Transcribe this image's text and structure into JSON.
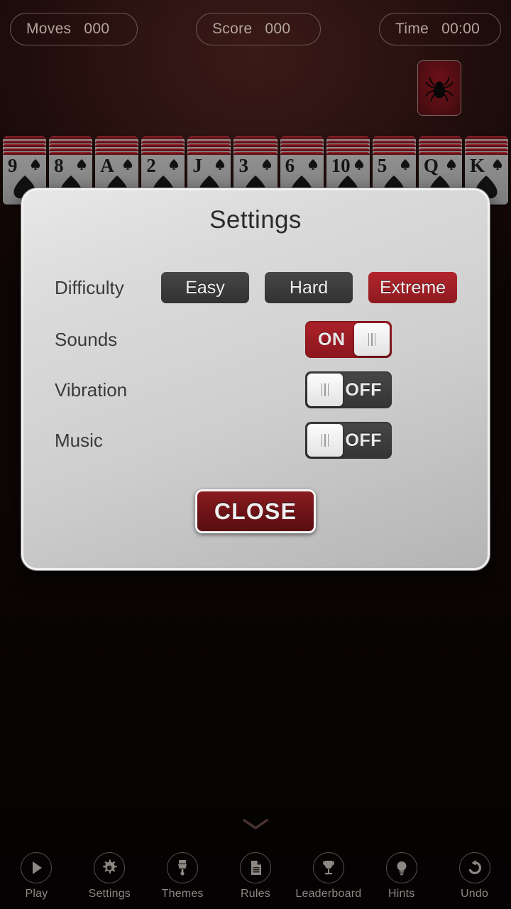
{
  "status": {
    "moves": {
      "label": "Moves",
      "value": "000"
    },
    "score": {
      "label": "Score",
      "value": "000"
    },
    "time": {
      "label": "Time",
      "value": "00:00"
    }
  },
  "stock": {
    "icon": "spider-icon"
  },
  "cards": [
    {
      "rank": "9",
      "suit": "spade"
    },
    {
      "rank": "8",
      "suit": "spade"
    },
    {
      "rank": "A",
      "suit": "spade"
    },
    {
      "rank": "2",
      "suit": "spade"
    },
    {
      "rank": "J",
      "suit": "spade"
    },
    {
      "rank": "3",
      "suit": "spade"
    },
    {
      "rank": "6",
      "suit": "spade"
    },
    {
      "rank": "10",
      "suit": "spade"
    },
    {
      "rank": "5",
      "suit": "spade"
    },
    {
      "rank": "Q",
      "suit": "spade"
    },
    {
      "rank": "K",
      "suit": "spade"
    }
  ],
  "dialog": {
    "title": "Settings",
    "difficulty": {
      "label": "Difficulty",
      "options": [
        "Easy",
        "Hard",
        "Extreme"
      ],
      "selected": "Extreme"
    },
    "sounds": {
      "label": "Sounds",
      "state": "ON"
    },
    "vibration": {
      "label": "Vibration",
      "state": "OFF"
    },
    "music": {
      "label": "Music",
      "state": "OFF"
    },
    "close_label": "CLOSE"
  },
  "chevron": {
    "icon": "chevron-down-icon"
  },
  "nav": [
    {
      "label": "Play",
      "icon": "play-icon"
    },
    {
      "label": "Settings",
      "icon": "gear-icon"
    },
    {
      "label": "Themes",
      "icon": "paintbrush-icon"
    },
    {
      "label": "Rules",
      "icon": "document-icon"
    },
    {
      "label": "Leaderboard",
      "icon": "trophy-icon"
    },
    {
      "label": "Hints",
      "icon": "lightbulb-icon"
    },
    {
      "label": "Undo",
      "icon": "undo-arrow-icon"
    }
  ],
  "colors": {
    "background": "#1d0c0a",
    "accent_red": "#a52229",
    "toggle_on": "#ad2129",
    "toggle_off": "#3f3f3f",
    "dialog_bg": "#cfcfcf",
    "nav_icon": "#8d8884"
  }
}
